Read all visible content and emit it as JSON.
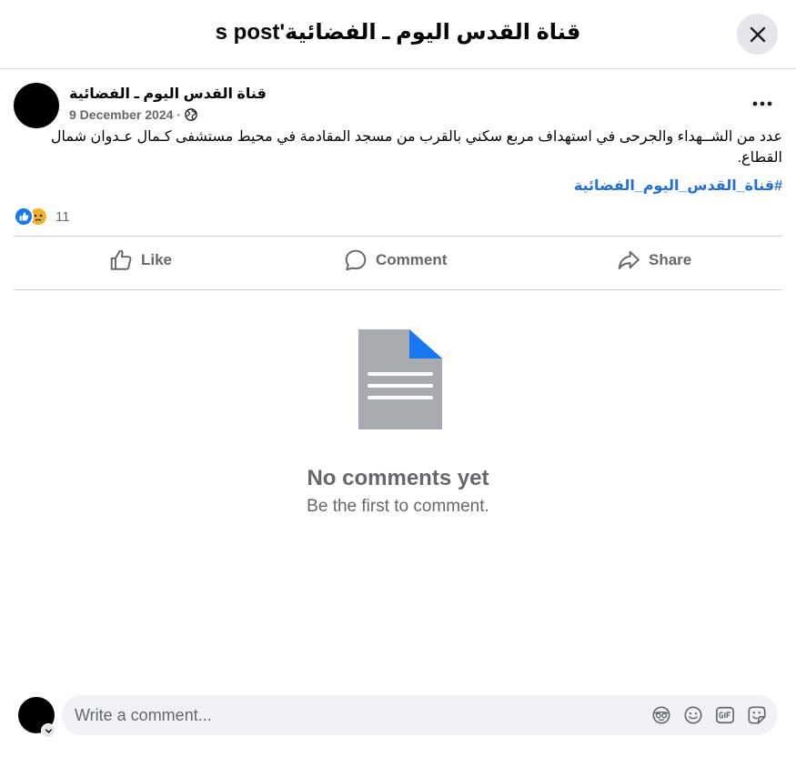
{
  "dialog": {
    "title": "قناة القدس اليوم ـ الفضائية's post",
    "close_icon": "close-icon"
  },
  "post": {
    "page_name": "قناة القدس اليوم ـ الفضائية",
    "date": "9 December 2024",
    "separator": "·",
    "privacy_icon": "globe-icon",
    "more_icon": "more-options-icon",
    "body": "عدد من الشــهداء والجرحى في استهداف مربع سكني بالقرب من مسجد المقادمة في محيط مستشفى كـمال عـدوان شمال القطاع.",
    "hashtag": "#قناة_القدس_اليوم_الفضائية"
  },
  "reactions": {
    "types": [
      "like",
      "sad"
    ],
    "count": "11"
  },
  "actions": {
    "like_label": "Like",
    "comment_label": "Comment",
    "share_label": "Share"
  },
  "empty_state": {
    "title": "No comments yet",
    "subtitle": "Be the first to comment."
  },
  "composer": {
    "placeholder": "Write a comment...",
    "icons": [
      "avatar-sticker-icon",
      "emoji-icon",
      "gif-icon",
      "sticker-icon"
    ]
  },
  "colors": {
    "link": "#216fdb",
    "like_blue": "#1877f2",
    "muted_text": "#65676b",
    "doc_gray": "#a8abaf"
  }
}
